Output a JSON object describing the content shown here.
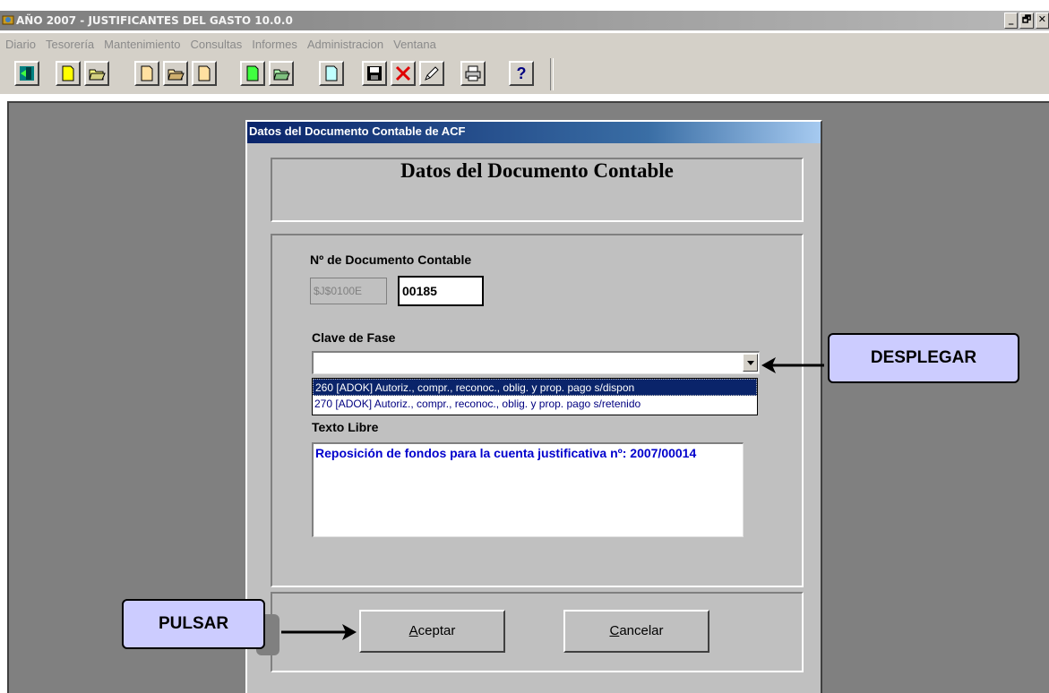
{
  "window": {
    "title": "AÑO 2007 - JUSTIFICANTES DEL GASTO 10.0.0",
    "controls": [
      "_",
      "🗗",
      "✕"
    ]
  },
  "menu": [
    "Diario",
    "Tesorería",
    "Mantenimiento",
    "Consultas",
    "Informes",
    "Administracion",
    "Ventana"
  ],
  "toolbar": {
    "buttons": [
      "exit-icon",
      "new-doc-icon",
      "open-folder-icon",
      "new-doc-icon",
      "open-folder-icon",
      "new-doc-icon",
      "new-doc-green-icon",
      "open-folder-icon",
      "new-doc-icon",
      "save-icon",
      "delete-icon",
      "edit-icon",
      "print-icon",
      "help-icon"
    ],
    "help_label": "?"
  },
  "dialog": {
    "title": "Datos del Documento Contable de ACF",
    "header": "Datos del Documento Contable",
    "doc_number_label": "Nº de Documento Contable",
    "doc_prefix": "$J$0100E",
    "doc_number": "00185",
    "phase_label": "Clave de Fase",
    "phase_value": "",
    "phase_options": [
      "260 [ADOK] Autoriz., compr., reconoc., oblig. y prop. pago s/dispon",
      "270 [ADOK] Autoriz., compr., reconoc., oblig. y prop. pago s/retenido"
    ],
    "free_text_label": "Texto Libre",
    "free_text": "Reposición de fondos para la cuenta justificativa nº: 2007/00014",
    "accept_label": "Aceptar",
    "cancel_label": "Cancelar"
  },
  "callouts": {
    "dropdown": "DESPLEGAR",
    "press": "PULSAR"
  },
  "colors": {
    "dialog_title_start": "#0a246a",
    "callout_fill": "#ccccff",
    "free_text": "#0000cc"
  }
}
